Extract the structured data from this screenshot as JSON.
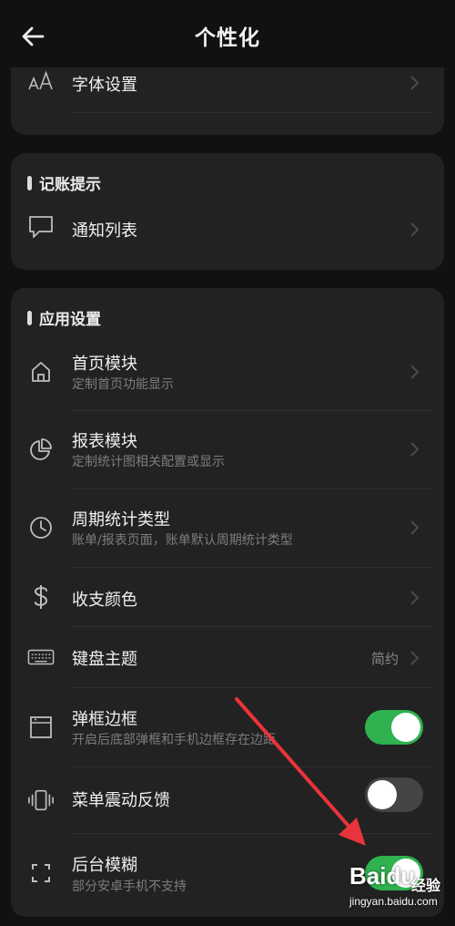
{
  "header": {
    "title": "个性化"
  },
  "section_font": {
    "item": {
      "label": "字体设置",
      "icon": "font-size-icon"
    }
  },
  "section_reminder": {
    "title": "记账提示",
    "item": {
      "label": "通知列表",
      "icon": "chat-bubble-icon"
    }
  },
  "section_app": {
    "title": "应用设置",
    "items": [
      {
        "label": "首页模块",
        "sub": "定制首页功能显示",
        "icon": "home-icon"
      },
      {
        "label": "报表模块",
        "sub": "定制统计图相关配置或显示",
        "icon": "pie-chart-icon"
      },
      {
        "label": "周期统计类型",
        "sub": "账单/报表页面，账单默认周期统计类型",
        "icon": "clock-icon"
      },
      {
        "label": "收支颜色",
        "icon": "dollar-icon"
      },
      {
        "label": "键盘主题",
        "value": "简约",
        "icon": "keyboard-icon"
      },
      {
        "label": "弹框边框",
        "sub": "开启后底部弹框和手机边框存在边距",
        "icon": "frame-icon",
        "toggle": true
      },
      {
        "label": "菜单震动反馈",
        "icon": "vibrate-icon",
        "toggle": false
      },
      {
        "label": "后台模糊",
        "sub": "部分安卓手机不支持",
        "icon": "blur-corners-icon",
        "toggle": true
      }
    ]
  },
  "colors": {
    "background": "#111111",
    "card": "#222222",
    "toggle_on": "#2fb24f",
    "toggle_off": "#444444",
    "annotation_arrow": "#e8343c"
  },
  "watermark": {
    "logo": "Baidu",
    "suffix": "经验",
    "url": "jingyan.baidu.com"
  }
}
